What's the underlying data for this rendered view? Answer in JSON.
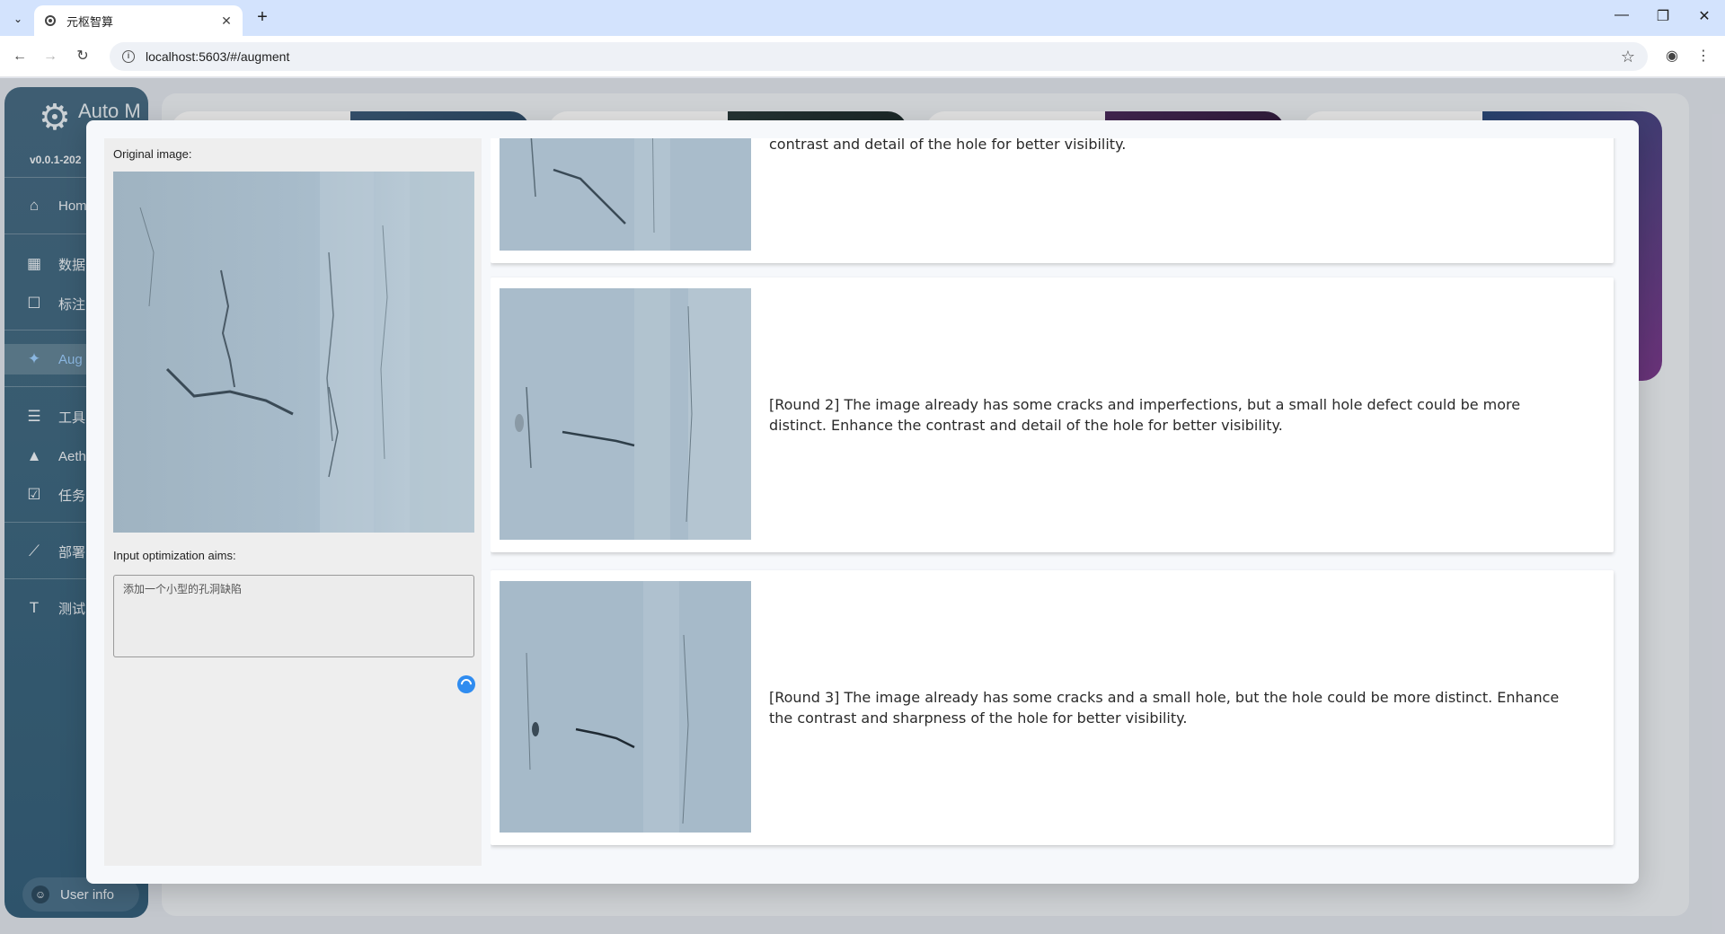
{
  "browser": {
    "tab_title": "元枢智算",
    "url": "localhost:5603/#/augment"
  },
  "sidebar": {
    "logo_text": "Auto M",
    "version": "v0.0.1-202",
    "items": [
      {
        "label": "Hom",
        "icon": "home-icon"
      },
      {
        "label": "数据",
        "icon": "grid-icon"
      },
      {
        "label": "标注",
        "icon": "square-icon"
      },
      {
        "label": "Aug",
        "icon": "augment-icon"
      },
      {
        "label": "工具",
        "icon": "list-icon"
      },
      {
        "label": "Aeth",
        "icon": "rocket-icon"
      },
      {
        "label": "任务",
        "icon": "checklist-icon"
      },
      {
        "label": "部署",
        "icon": "chart-line-icon"
      },
      {
        "label": "测试",
        "icon": "text-icon"
      }
    ],
    "user_info": "User info"
  },
  "dialog": {
    "original_label": "Original image:",
    "aims_label": "Input optimization aims:",
    "aims_value": "添加一个小型的孔洞缺陷",
    "rounds": [
      {
        "text": "contrast and detail of the hole for better visibility."
      },
      {
        "text": "[Round 2] The image already has some cracks and imperfections, but a small hole defect could be more distinct. Enhance the contrast and detail of the hole for better visibility."
      },
      {
        "text": "[Round 3] The image already has some cracks and a small hole, but the hole could be more distinct. Enhance the contrast and sharpness of the hole for better visibility."
      }
    ]
  },
  "colors": {
    "accent": "#2f8cf0",
    "sidebar": "#3f6880",
    "tabbar": "#d3e3fd"
  }
}
